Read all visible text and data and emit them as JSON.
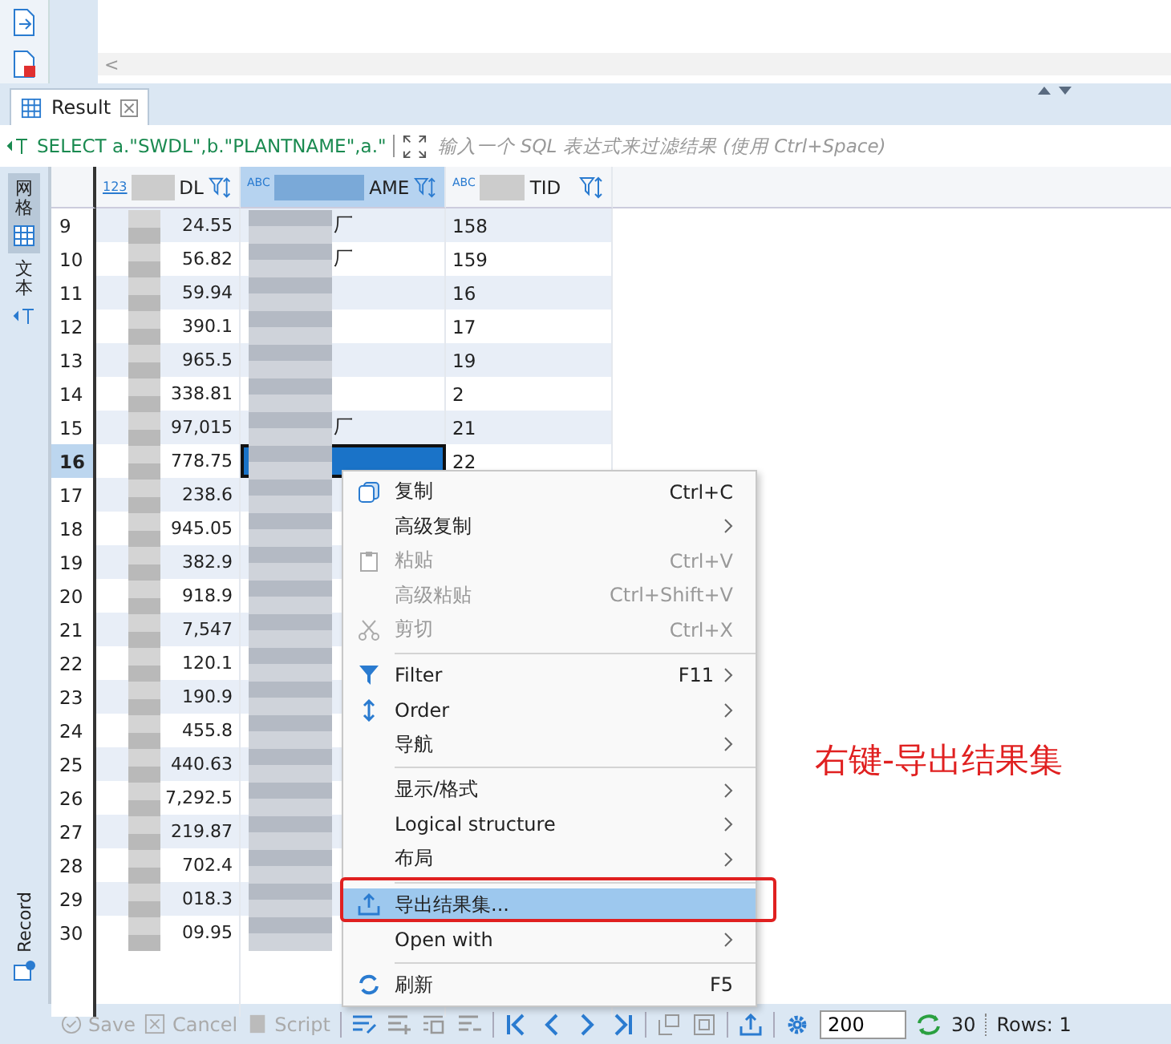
{
  "editor": {
    "scroll_arrow": "<"
  },
  "result_tab": {
    "label": "Result"
  },
  "filter": {
    "query": "SELECT a.\"SWDL\",b.\"PLANTNAME\",a.\"",
    "placeholder": "输入一个 SQL 表达式来过滤结果 (使用 Ctrl+Space)"
  },
  "side_tabs": [
    {
      "label": "网格",
      "selected": true
    },
    {
      "label": "文本",
      "selected": false
    }
  ],
  "record_tab": {
    "label": "Record"
  },
  "columns": [
    {
      "label": "DL",
      "type_label": "123",
      "kind": "number",
      "selected": false
    },
    {
      "label": "AME",
      "type_label": "ABC",
      "kind": "text",
      "selected": true
    },
    {
      "label": "TID",
      "type_label": "ABC",
      "kind": "text",
      "selected": false
    }
  ],
  "rows": [
    {
      "num": "9",
      "amount": "24.55",
      "plant": "厂",
      "tid": "158",
      "selected": false
    },
    {
      "num": "10",
      "amount": "56.82",
      "plant": "厂",
      "tid": "159",
      "selected": false
    },
    {
      "num": "11",
      "amount": "59.94",
      "tid": "16",
      "selected": false
    },
    {
      "num": "12",
      "amount": "390.1",
      "tid": "17",
      "selected": false
    },
    {
      "num": "13",
      "amount": "965.5",
      "tid": "19",
      "selected": false
    },
    {
      "num": "14",
      "amount": "338.81",
      "tid": "2",
      "selected": false
    },
    {
      "num": "15",
      "amount": "97,015",
      "plant": "厂",
      "tid": "21",
      "selected": false
    },
    {
      "num": "16",
      "amount": "778.75",
      "tid": "22",
      "selected": true
    },
    {
      "num": "17",
      "amount": "238.6",
      "selected": false
    },
    {
      "num": "18",
      "amount": "945.05",
      "selected": false
    },
    {
      "num": "19",
      "amount": "382.9",
      "selected": false
    },
    {
      "num": "20",
      "amount": "918.9",
      "selected": false
    },
    {
      "num": "21",
      "amount": "7,547",
      "selected": false
    },
    {
      "num": "22",
      "amount": "120.1",
      "selected": false
    },
    {
      "num": "23",
      "amount": "190.9",
      "selected": false
    },
    {
      "num": "24",
      "amount": "455.8",
      "selected": false
    },
    {
      "num": "25",
      "amount": "440.63",
      "selected": false
    },
    {
      "num": "26",
      "amount": "7,292.5",
      "selected": false
    },
    {
      "num": "27",
      "amount": "219.87",
      "selected": false
    },
    {
      "num": "28",
      "amount": "702.4",
      "selected": false
    },
    {
      "num": "29",
      "amount": "018.3",
      "selected": false
    },
    {
      "num": "30",
      "amount": "09.95",
      "selected": false
    }
  ],
  "context_menu": [
    {
      "kind": "item",
      "label": "复制",
      "shortcut": "Ctrl+C",
      "submenu": false,
      "disabled": false,
      "selected": false
    },
    {
      "kind": "item",
      "label": "高级复制",
      "submenu": true,
      "disabled": false,
      "selected": false
    },
    {
      "kind": "item",
      "label": "粘贴",
      "shortcut": "Ctrl+V",
      "submenu": false,
      "disabled": true,
      "selected": false
    },
    {
      "kind": "item",
      "label": "高级粘贴",
      "shortcut": "Ctrl+Shift+V",
      "submenu": false,
      "disabled": true,
      "selected": false
    },
    {
      "kind": "item",
      "label": "剪切",
      "shortcut": "Ctrl+X",
      "submenu": false,
      "disabled": true,
      "selected": false
    },
    {
      "kind": "separator"
    },
    {
      "kind": "item",
      "label": "Filter",
      "shortcut": "F11",
      "submenu": true,
      "disabled": false,
      "selected": false
    },
    {
      "kind": "item",
      "label": "Order",
      "submenu": true,
      "disabled": false,
      "selected": false
    },
    {
      "kind": "item",
      "label": "导航",
      "submenu": true,
      "disabled": false,
      "selected": false
    },
    {
      "kind": "separator"
    },
    {
      "kind": "item",
      "label": "显示/格式",
      "submenu": true,
      "disabled": false,
      "selected": false
    },
    {
      "kind": "item",
      "label": "Logical structure",
      "submenu": true,
      "disabled": false,
      "selected": false
    },
    {
      "kind": "item",
      "label": "布局",
      "submenu": true,
      "disabled": false,
      "selected": false
    },
    {
      "kind": "separator"
    },
    {
      "kind": "item",
      "label": "导出结果集...",
      "submenu": false,
      "disabled": false,
      "selected": true
    },
    {
      "kind": "item",
      "label": "Open with",
      "submenu": true,
      "disabled": false,
      "selected": false
    },
    {
      "kind": "separator"
    },
    {
      "kind": "item",
      "label": "刷新",
      "shortcut": "F5",
      "submenu": false,
      "disabled": false,
      "selected": false
    }
  ],
  "toolbar": {
    "save": "Save",
    "cancel": "Cancel",
    "script": "Script",
    "fetch_size": "200",
    "count": "30",
    "rows": "Rows: 1"
  },
  "annotation": {
    "text": "右键-导出结果集"
  }
}
